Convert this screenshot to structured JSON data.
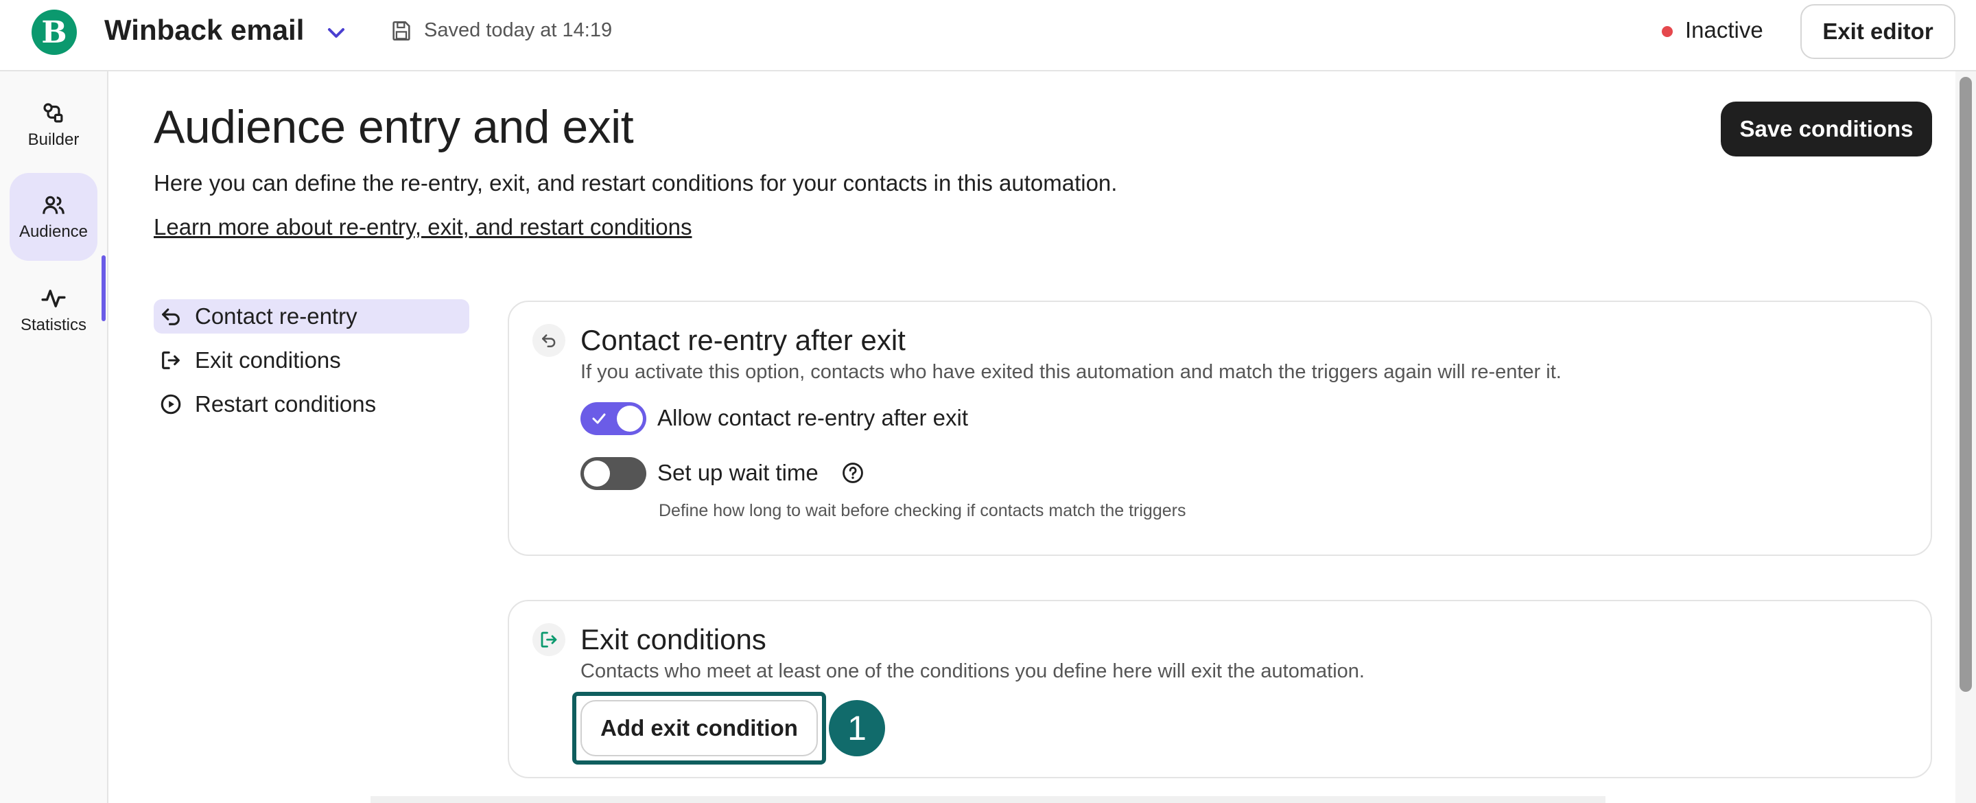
{
  "header": {
    "logo_letter": "B",
    "title": "Winback email",
    "saved_text": "Saved today at 14:19",
    "status": "Inactive",
    "status_color": "#e5484d",
    "exit_editor_label": "Exit editor",
    "icons": [
      "brevo-logo",
      "chevron-down-icon",
      "save-icon"
    ]
  },
  "sidebar": {
    "items": [
      {
        "label": "Builder",
        "icon": "builder-icon",
        "active": false
      },
      {
        "label": "Audience",
        "icon": "audience-icon",
        "active": true
      },
      {
        "label": "Statistics",
        "icon": "statistics-icon",
        "active": false
      }
    ],
    "accent_color": "#6b5ce7"
  },
  "main": {
    "title": "Audience entry and exit",
    "description": "Here you can define the re-entry, exit, and restart conditions for your contacts in this automation.",
    "learn_more_link": "Learn more about re-entry, exit, and restart conditions",
    "save_button": "Save conditions",
    "section_nav": [
      {
        "label": "Contact re-entry",
        "icon": "undo-arrow-icon",
        "active": true
      },
      {
        "label": "Exit conditions",
        "icon": "exit-icon",
        "active": false
      },
      {
        "label": "Restart conditions",
        "icon": "play-circle-icon",
        "active": false
      }
    ],
    "reentry_card": {
      "title": "Contact re-entry after exit",
      "description": "If you activate this option, contacts who have exited this automation and match the triggers again will re-enter it.",
      "toggle_allow": {
        "label": "Allow contact re-entry after exit",
        "on": true
      },
      "toggle_wait": {
        "label": "Set up wait time",
        "on": false
      },
      "wait_hint": "Define how long to wait before checking if contacts match the triggers"
    },
    "exit_card": {
      "title": "Exit conditions",
      "description": "Contacts who meet at least one of the conditions you define here will exit the automation.",
      "add_button": "Add exit condition",
      "step_badge": "1"
    }
  }
}
